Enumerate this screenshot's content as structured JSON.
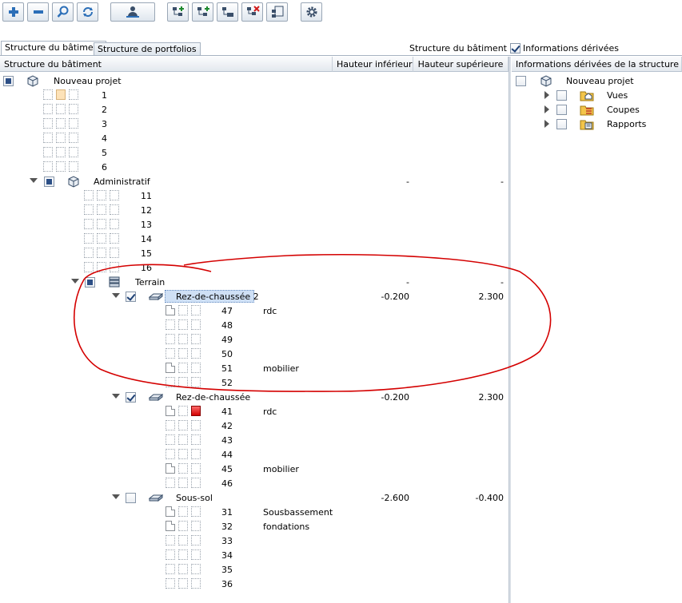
{
  "tabs": [
    "Structure du bâtiment",
    "Structure de portfolios"
  ],
  "top_options": {
    "structure_label": "Structure du bâtiment",
    "derived_label": "Informations dérivées"
  },
  "headers": {
    "structure": "Structure du bâtiment",
    "lower": "Hauteur inférieure",
    "upper": "Hauteur supérieure",
    "derived": "Informations dérivées de la structure du bâtiment"
  },
  "tree": {
    "project": "Nouveau projet",
    "project_items": [
      "1",
      "2",
      "3",
      "4",
      "5",
      "6"
    ],
    "admin": {
      "label": "Administratif",
      "lower": "-",
      "upper": "-"
    },
    "admin_items": [
      "11",
      "12",
      "13",
      "14",
      "15",
      "16"
    ],
    "terrain": {
      "label": "Terrain",
      "lower": "-",
      "upper": "-"
    },
    "rdc2": {
      "label": "Rez-de-chaussée 2",
      "lower": "-0.200",
      "upper": "2.300",
      "items": [
        {
          "n": "47",
          "t": "rdc"
        },
        {
          "n": "48",
          "t": ""
        },
        {
          "n": "49",
          "t": ""
        },
        {
          "n": "50",
          "t": ""
        },
        {
          "n": "51",
          "t": "mobilier"
        },
        {
          "n": "52",
          "t": ""
        }
      ]
    },
    "rdc": {
      "label": "Rez-de-chaussée",
      "lower": "-0.200",
      "upper": "2.300",
      "items": [
        {
          "n": "41",
          "t": "rdc"
        },
        {
          "n": "42",
          "t": ""
        },
        {
          "n": "43",
          "t": ""
        },
        {
          "n": "44",
          "t": ""
        },
        {
          "n": "45",
          "t": "mobilier"
        },
        {
          "n": "46",
          "t": ""
        }
      ]
    },
    "soussol": {
      "label": "Sous-sol",
      "lower": "-2.600",
      "upper": "-0.400",
      "items": [
        {
          "n": "31",
          "t": "Sousbassement"
        },
        {
          "n": "32",
          "t": "fondations"
        },
        {
          "n": "33",
          "t": ""
        },
        {
          "n": "34",
          "t": ""
        },
        {
          "n": "35",
          "t": ""
        },
        {
          "n": "36",
          "t": ""
        }
      ]
    }
  },
  "derived": {
    "project": "Nouveau projet",
    "items": [
      "Vues",
      "Coupes",
      "Rapports"
    ]
  }
}
